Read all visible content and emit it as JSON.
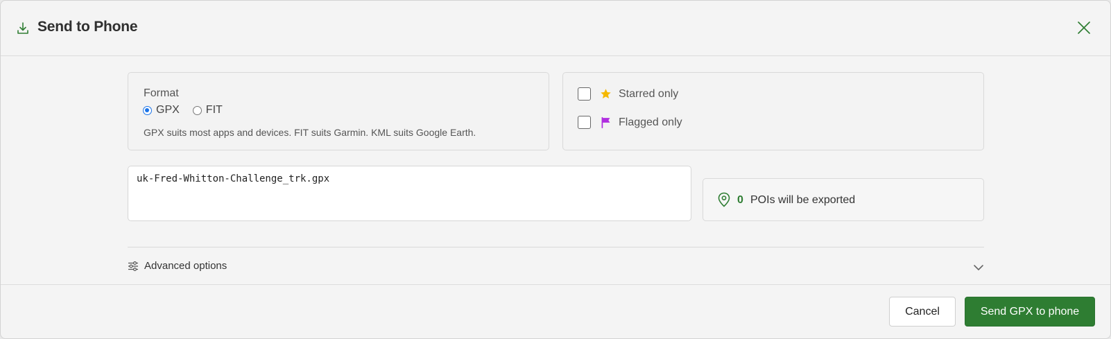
{
  "dialog": {
    "title": "Send to Phone",
    "icon": "download-icon",
    "close_icon": "close-icon"
  },
  "format": {
    "label": "Format",
    "options": [
      {
        "label": "GPX",
        "selected": true
      },
      {
        "label": "FIT",
        "selected": false
      }
    ],
    "hint": "GPX suits most apps and devices. FIT suits Garmin. KML suits Google Earth."
  },
  "filters": [
    {
      "label": "Starred only",
      "checked": false,
      "icon": "star-icon",
      "icon_color": "#f5b800"
    },
    {
      "label": "Flagged only",
      "checked": false,
      "icon": "flag-icon",
      "icon_color": "#b02ee0"
    }
  ],
  "filename": {
    "value": "uk-Fred-Whitton-Challenge_trk.gpx"
  },
  "poi": {
    "count": "0",
    "text": "POIs will be exported",
    "icon": "map-pin-icon"
  },
  "advanced": {
    "label": "Advanced options",
    "expanded": false
  },
  "buttons": {
    "cancel": "Cancel",
    "send": "Send GPX to phone"
  },
  "colors": {
    "accent": "#2e7d32",
    "radio": "#1a73e8"
  }
}
